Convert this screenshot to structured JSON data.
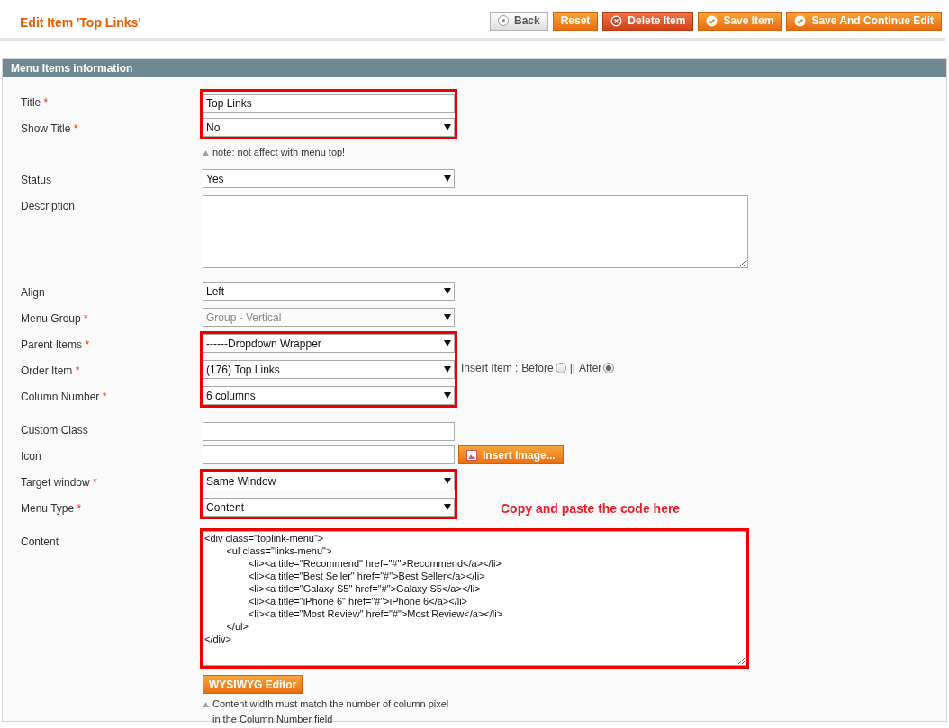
{
  "page_title": "Edit Item 'Top Links'",
  "buttons": [
    {
      "label": "Back",
      "kind": "back"
    },
    {
      "label": "Reset",
      "kind": "plain"
    },
    {
      "label": "Delete Item",
      "kind": "delete"
    },
    {
      "label": "Save Item",
      "kind": "save"
    },
    {
      "label": "Save And Continue Edit",
      "kind": "save"
    }
  ],
  "section_title": "Menu Items information",
  "required_mark": "*",
  "groups": [
    {
      "highlighted": true,
      "fields": [
        {
          "label": "Title",
          "required": true,
          "kind": "text",
          "value": "Top Links"
        },
        {
          "label": "Show Title",
          "required": true,
          "kind": "select",
          "value": "No",
          "disabled": false,
          "notes": [
            "note: not affect with menu top!"
          ]
        }
      ]
    },
    {
      "highlighted": false,
      "fields": [
        {
          "label": "Status",
          "required": false,
          "kind": "select",
          "value": "Yes",
          "disabled": false
        },
        {
          "label": "Description",
          "required": false,
          "kind": "textarea"
        },
        {
          "label": "Align",
          "required": false,
          "kind": "select",
          "value": "Left",
          "disabled": false
        },
        {
          "label": "Menu Group",
          "required": true,
          "kind": "select",
          "value": "Group - Vertical",
          "disabled": true
        }
      ]
    },
    {
      "highlighted": true,
      "fields": [
        {
          "label": "Parent Items",
          "required": true,
          "kind": "select",
          "value": "------Dropdown Wrapper",
          "disabled": false
        },
        {
          "label": "Order Item",
          "required": true,
          "kind": "select",
          "value": "(176) Top Links",
          "disabled": false,
          "insert": {
            "label": "Insert Item :",
            "separator": "||",
            "options": [
              {
                "label": "Before",
                "selected": false
              },
              {
                "label": "After",
                "selected": true
              }
            ]
          }
        },
        {
          "label": "Column Number",
          "required": true,
          "kind": "select",
          "value": "6 columns",
          "disabled": false
        }
      ]
    },
    {
      "highlighted": false,
      "fields": [
        {
          "label": "Custom Class",
          "required": false,
          "kind": "text"
        },
        {
          "label": "Icon",
          "required": false,
          "kind": "image",
          "button": "Insert Image..."
        }
      ]
    },
    {
      "highlighted": true,
      "fields": [
        {
          "label": "Target window",
          "required": true,
          "kind": "select",
          "value": "Same Window",
          "disabled": false
        },
        {
          "label": "Menu Type",
          "required": true,
          "kind": "select",
          "value": "Content",
          "disabled": false,
          "annotation": "Copy and paste the code here"
        }
      ]
    },
    {
      "highlighted": true,
      "fields": [
        {
          "label": "Content",
          "required": false,
          "kind": "code",
          "value": "<div class=\"toplink-menu\">\n        <ul class=\"links-menu\">\n                <li><a title=\"Recommend\" href=\"#\">Recommend</a></li>\n                <li><a title=\"Best Seller\" href=\"#\">Best Seller</a></li>\n                <li><a title=\"Galaxy S5\" href=\"#\">Galaxy S5</a></li>\n                <li><a title=\"iPhone 6\" href=\"#\">iPhone 6</a></li>\n                <li><a title=\"Most Review\" href=\"#\">Most Review</a></li>\n        </ul>\n</div>",
          "button": "WYSIWYG Editor",
          "notes": [
            "Content width must match the number of column pixel",
            "in the Column Number field"
          ]
        }
      ]
    }
  ]
}
